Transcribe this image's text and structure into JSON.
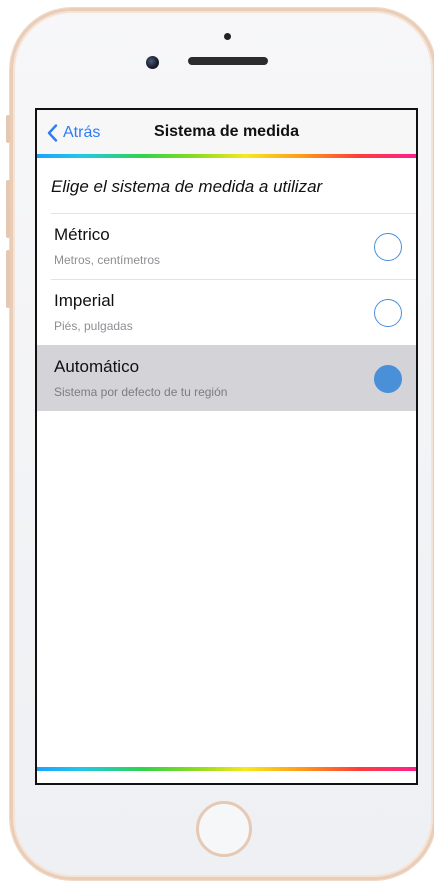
{
  "navbar": {
    "back_label": "Atrás",
    "title": "Sistema de medida"
  },
  "instruction": "Elige el sistema de medida a utilizar",
  "options": [
    {
      "label": "Métrico",
      "subtitle": "Metros, centímetros",
      "selected": false
    },
    {
      "label": "Imperial",
      "subtitle": "Piés, pulgadas",
      "selected": false
    },
    {
      "label": "Automático",
      "subtitle": "Sistema por defecto de tu región",
      "selected": true
    }
  ],
  "colors": {
    "accent": "#2f7cf6",
    "radio": "#4a90d9",
    "selected_row": "#d3d3d8",
    "phone_frame": "#e9cdb7"
  }
}
